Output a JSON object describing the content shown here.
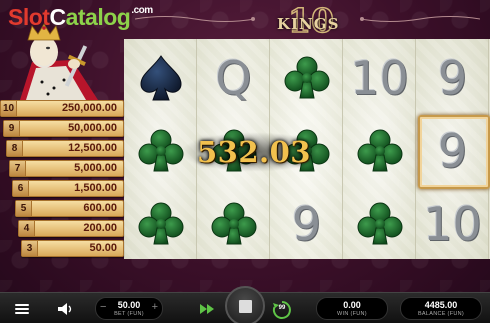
{
  "watermark": {
    "part1": "Slot",
    "part2": "C",
    "part3": "atalog",
    "part4": ".com"
  },
  "game_logo": {
    "number": "10",
    "word": "KINGS"
  },
  "paytable": [
    {
      "count": "10",
      "payout": "250,000.00"
    },
    {
      "count": "9",
      "payout": "50,000.00"
    },
    {
      "count": "8",
      "payout": "12,500.00"
    },
    {
      "count": "7",
      "payout": "5,000.00"
    },
    {
      "count": "6",
      "payout": "1,500.00"
    },
    {
      "count": "5",
      "payout": "600.00"
    },
    {
      "count": "4",
      "payout": "200.00"
    },
    {
      "count": "3",
      "payout": "50.00"
    }
  ],
  "reels": [
    [
      "spade",
      "club",
      "club"
    ],
    [
      "Q",
      "club",
      "club"
    ],
    [
      "club",
      "club",
      "9"
    ],
    [
      "10",
      "club",
      "club"
    ],
    [
      "9",
      "9",
      "10"
    ]
  ],
  "win_amount": "532.03",
  "bottom_bar": {
    "bet_value": "50.00",
    "bet_label": "BET (FUN)",
    "win_value": "0.00",
    "win_label": "WIN (FUN)",
    "balance_value": "4485.00",
    "balance_label": "BALANCE (FUN)",
    "autoplay_count": "99"
  },
  "colors": {
    "club_green": "#1e6b2e",
    "spade_navy": "#1c2a44",
    "gold_text": "#f2c14e",
    "background": "#3a0f28"
  }
}
